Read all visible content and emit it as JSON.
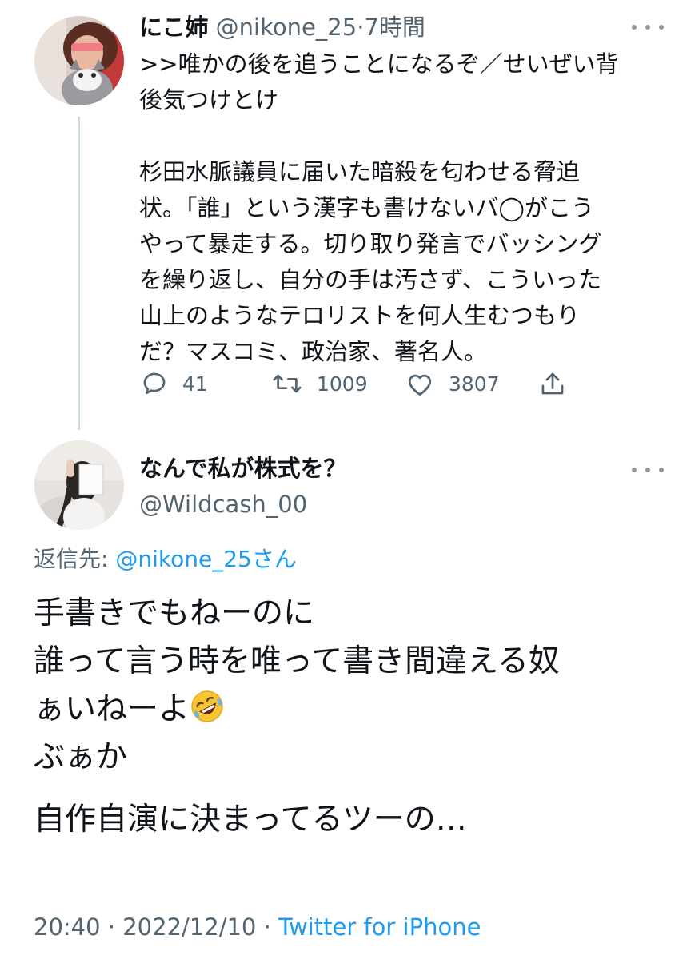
{
  "tweet1": {
    "author_name": "にこ姉",
    "handle": "@nikone_25",
    "separator": "·",
    "time": "7時間",
    "body_paragraph1": ">>唯かの後を追うことになるぞ／せいぜい背\n後気つけとけ",
    "body_paragraph2": "杉田水脈議員に届いた暗殺を匂わせる脅迫\n状。「誰」という漢字も書けないバ◯がこう\nやって暴走する。切り取り発言でバッシング\nを繰り返し、自分の手は汚さず、こういった\n山上のようなテロリストを何人生むつもり\nだ？マスコミ、政治家、著名人。",
    "actions": {
      "reply_count": "41",
      "retweet_count": "1009",
      "like_count": "3807"
    }
  },
  "tweet2": {
    "author_name": "なんで私が株式を？",
    "handle": "@Wildcash_00",
    "reply_to_label": "返信先:",
    "reply_to_mention": "@nikone_25",
    "reply_to_suffix": "さん",
    "body_lines": [
      "手書きでもねーのに",
      "誰って言う時を唯って書き間違える奴",
      "ぁいねーよ",
      "ぶぁか",
      "自作自演に決まってるツーの…"
    ],
    "emoji": "rolling-on-floor-laughing-emoji",
    "meta_time": "20:40",
    "meta_sep1": "·",
    "meta_date": "2022/12/10",
    "meta_sep2": "·",
    "meta_source": "Twitter for iPhone"
  },
  "colors": {
    "text_primary": "#0f1419",
    "text_secondary": "#536471",
    "link": "#1d9bf0",
    "thread_line": "#cfd9de"
  }
}
